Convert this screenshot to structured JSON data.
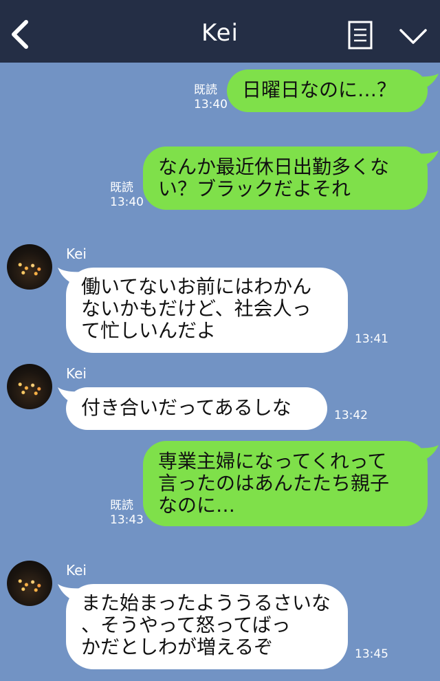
{
  "header": {
    "title": "Kei"
  },
  "messages": [
    {
      "type": "sent",
      "text": "日曜日なのに…？",
      "read": "既読",
      "time": "13:40"
    },
    {
      "type": "sent",
      "text": "なんか最近休日出勤多くな\nい？ブラックだよそれ",
      "read": "既読",
      "time": "13:40"
    },
    {
      "type": "received",
      "sender": "Kei",
      "text": "働いてないお前にはわかん\nないかもだけど、社会人っ\nて忙しいんだよ",
      "time": "13:41"
    },
    {
      "type": "received",
      "sender": "Kei",
      "text": "付き合いだってあるしな",
      "time": "13:42"
    },
    {
      "type": "sent",
      "text": "専業主婦になってくれって\n言ったのはあんたたち親子\nなのに…",
      "read": "既読",
      "time": "13:43"
    },
    {
      "type": "received",
      "sender": "Kei",
      "text": "また始まったよううるさいな\n、そうやって怒ってばっ\nかだとしわが増えるぞ",
      "time": "13:45"
    }
  ],
  "colors": {
    "header_bg": "#242e45",
    "chat_bg": "#7293c4",
    "sent_bubble": "#7fe04a",
    "received_bubble": "#ffffff"
  },
  "icons": [
    "back-arrow-icon",
    "menu-icon",
    "chevron-down-icon"
  ]
}
